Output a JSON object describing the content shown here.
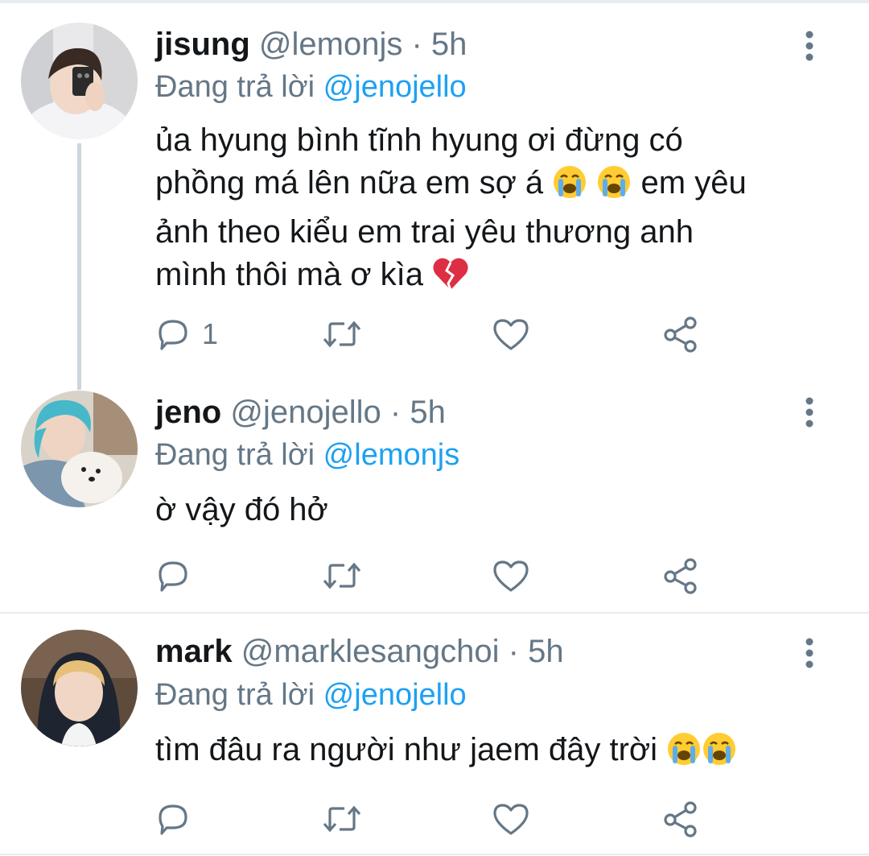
{
  "reply_prefix": "Đang trả lời",
  "tweets": [
    {
      "name": "jisung",
      "handle": "@lemonjs",
      "dot": "·",
      "time": "5h",
      "reply_to": "@jenojello",
      "text_lines": [
        "ủa hyung bình tĩnh hyung ơi đừng có",
        "phồng má lên nữa em sợ á",
        "em yêu",
        "ảnh theo kiểu em trai yêu thương anh",
        "mình thôi mà ơ kìa"
      ],
      "reply_count": "1",
      "avatar_icon": "person-avatar-holding-phone"
    },
    {
      "name": "jeno",
      "handle": "@jenojello",
      "dot": "·",
      "time": "5h",
      "reply_to": "@lemonjs",
      "text_lines": [
        "ờ vậy đó hở"
      ],
      "reply_count": "",
      "avatar_icon": "person-avatar-blue-hair-with-dog"
    },
    {
      "name": "mark",
      "handle": "@marklesangchoi",
      "dot": "·",
      "time": "5h",
      "reply_to": "@jenojello",
      "text_lines": [
        "tìm đâu ra người như jaem đây trời"
      ],
      "reply_count": "",
      "avatar_icon": "person-avatar-hoodie"
    }
  ],
  "icons": {
    "reply": "reply-icon",
    "retweet": "retweet-icon",
    "like": "heart-icon",
    "share": "share-icon",
    "more": "more-vertical-icon",
    "crying": "loudly-crying-face-emoji",
    "broken_heart": "broken-heart-emoji"
  },
  "colors": {
    "text": "#14171a",
    "muted": "#657786",
    "link": "#1da1f2",
    "divider": "#e6ecf0",
    "thread_line": "#ccd6dd"
  }
}
